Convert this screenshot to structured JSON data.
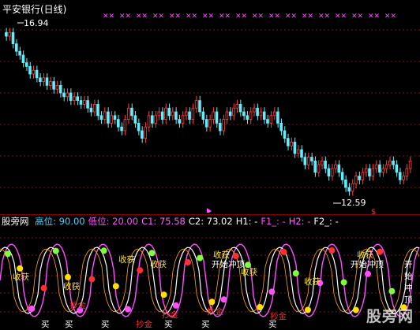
{
  "chart_title": "平安银行(日线)",
  "price": {
    "high_label": "16.94",
    "low_label": "12.59",
    "signal_mark": "$"
  },
  "indicator_bar": {
    "name": "股旁网",
    "items": [
      {
        "label": "高位:",
        "value": "90.00",
        "color": "#4fd0ff"
      },
      {
        "label": "低位:",
        "value": "20.00",
        "color": "#ff4fff"
      },
      {
        "label": "C1:",
        "value": "75.58",
        "color": "#ff66ff"
      },
      {
        "label": "C2:",
        "value": "73.02",
        "color": "#ffffff"
      },
      {
        "label": "H1:",
        "value": "-",
        "color": "#ffffff"
      },
      {
        "label": "F1_:",
        "value": "-",
        "color": "#ff4fff"
      },
      {
        "label": "H2:",
        "value": "-",
        "color": "#ff66ff"
      },
      {
        "label": "F2_:",
        "value": "-",
        "color": "#ffffff"
      }
    ]
  },
  "signals": {
    "harvest": "收获",
    "start_top": "开始冲顶",
    "gold": "抄金",
    "buy": "买"
  },
  "watermark": "股旁网",
  "chart_data": {
    "type": "candlestick",
    "title": "平安银行(日线)",
    "y_range": [
      12.2,
      17.2
    ],
    "high": 16.94,
    "low": 12.59,
    "close_approx": [
      16.7,
      16.8,
      16.5,
      16.3,
      16.2,
      16.0,
      15.9,
      15.7,
      15.8,
      15.6,
      15.5,
      15.6,
      15.4,
      15.5,
      15.3,
      15.4,
      15.2,
      15.1,
      15.2,
      15.0,
      15.1,
      15.0,
      14.9,
      15.0,
      14.8,
      14.7,
      14.9,
      14.6,
      14.5,
      14.7,
      14.4,
      14.6,
      14.5,
      14.3,
      14.2,
      14.5,
      14.8,
      14.6,
      14.4,
      14.2,
      14.0,
      14.3,
      14.6,
      14.4,
      14.6,
      14.7,
      14.5,
      14.8,
      14.6,
      14.7,
      14.5,
      14.4,
      14.6,
      14.7,
      14.5,
      14.8,
      15.0,
      14.7,
      14.5,
      14.3,
      14.5,
      14.7,
      14.4,
      14.2,
      14.5,
      14.7,
      14.6,
      14.8,
      14.9,
      14.7,
      14.6,
      14.5,
      14.7,
      14.8,
      14.6,
      14.7,
      14.5,
      14.4,
      14.6,
      14.7,
      14.4,
      14.2,
      14.0,
      13.8,
      13.9,
      13.6,
      13.7,
      13.5,
      13.3,
      13.5,
      13.4,
      13.1,
      13.3,
      13.4,
      13.2,
      13.0,
      13.2,
      13.3,
      13.1,
      12.9,
      12.7,
      12.6,
      12.8,
      13.0,
      12.9,
      13.1,
      13.2,
      13.0,
      13.2,
      13.3,
      13.1,
      13.2,
      13.3,
      13.4,
      13.3,
      13.1,
      12.9,
      13.0,
      13.2,
      13.4
    ]
  }
}
